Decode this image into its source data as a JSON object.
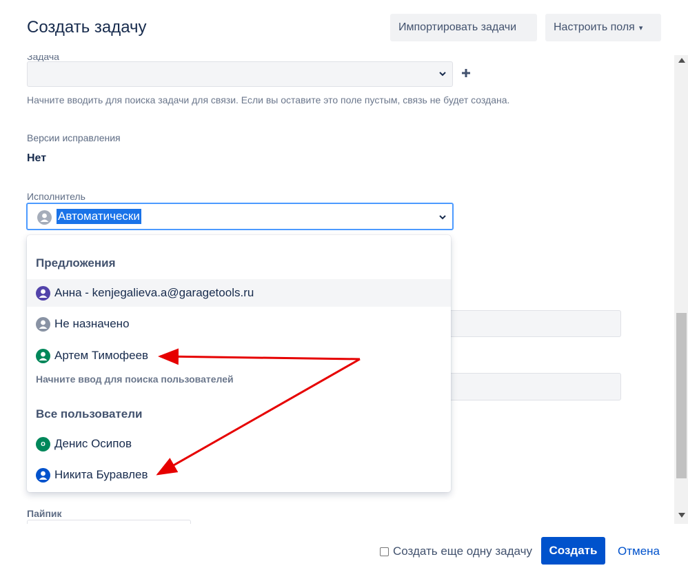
{
  "dialog": {
    "title": "Создать задачу",
    "import_button": "Импортировать задачи",
    "configure_button": "Настроить поля"
  },
  "form": {
    "task_label": "Задача",
    "task_help": "Начните вводить для поиска задачи для связи. Если вы оставите это поле пустым, связь не будет создана.",
    "versions_label": "Версии исправления",
    "versions_value": "Нет",
    "assignee_label": "Исполнитель",
    "assignee_value": "Автоматически",
    "pipik_label": "Пайпик"
  },
  "dropdown": {
    "suggestions_title": "Предложения",
    "suggestions": [
      {
        "name": "Анна - kenjegalieva.a@garagetools.ru",
        "avatar_color": "#5243aa",
        "highlighted": true
      },
      {
        "name": "Не назначено",
        "avatar_color": "#8993a4"
      },
      {
        "name": "Артем Тимофеев",
        "avatar_color": "#00875a"
      }
    ],
    "search_hint": "Начните ввод для поиска пользователей",
    "all_users_title": "Все пользователи",
    "all_users": [
      {
        "name": "Денис Осипов",
        "avatar_color": "#00875a",
        "avatar_letter": "o"
      },
      {
        "name": "Никита Буравлев",
        "avatar_color": "#0052cc"
      }
    ]
  },
  "footer": {
    "create_another_label": "Создать еще одну задачу",
    "create_another_checked": false,
    "create_button": "Создать",
    "cancel_link": "Отмена"
  },
  "colors": {
    "primary": "#0052cc",
    "annotation_arrow": "#e60000",
    "focus_border": "#4c9aff"
  }
}
